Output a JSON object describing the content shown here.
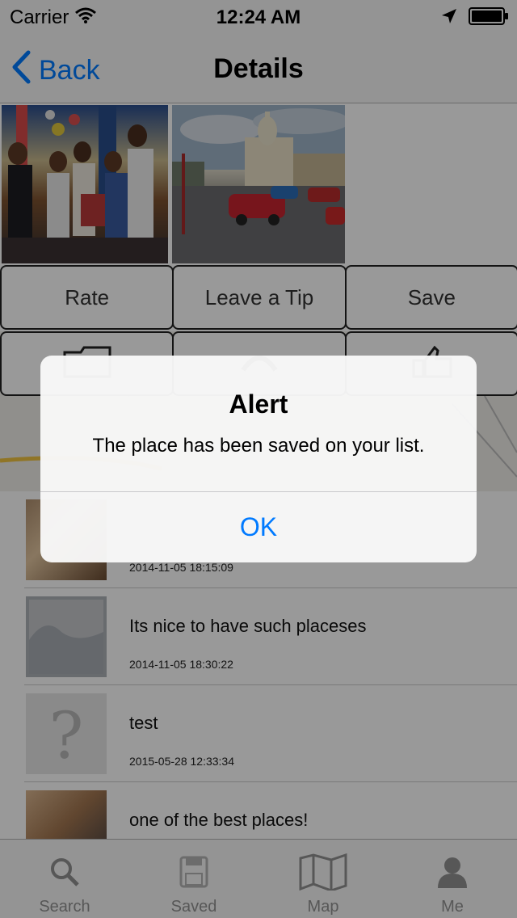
{
  "status": {
    "carrier": "Carrier",
    "time": "12:24 AM"
  },
  "nav": {
    "back_label": "Back",
    "title": "Details"
  },
  "actions": [
    {
      "label": "Rate"
    },
    {
      "label": "Leave a Tip"
    },
    {
      "label": "Save"
    }
  ],
  "icon_row": [
    {
      "icon": "folder-icon"
    },
    {
      "icon": "phone-icon"
    },
    {
      "icon": "thumbs-up-icon"
    }
  ],
  "list": [
    {
      "text": "",
      "date": "2014-11-05 18:15:09",
      "avatar": "user-photo"
    },
    {
      "text": "Its nice to have such placeses",
      "date": "2014-11-05 18:30:22",
      "avatar": "placeholder-image"
    },
    {
      "text": "test",
      "date": "2015-05-28 12:33:34",
      "avatar": "question-mark"
    },
    {
      "text": "one of the best places!",
      "date": "",
      "avatar": "user-photo"
    }
  ],
  "tabs": [
    {
      "label": "Search",
      "icon": "search-icon"
    },
    {
      "label": "Saved",
      "icon": "saved-icon"
    },
    {
      "label": "Map",
      "icon": "map-icon"
    },
    {
      "label": "Me",
      "icon": "person-icon"
    }
  ],
  "alert": {
    "title": "Alert",
    "message": "The place has been saved on your list.",
    "ok_label": "OK"
  },
  "colors": {
    "accent": "#007aff",
    "tab_inactive": "#929292"
  }
}
